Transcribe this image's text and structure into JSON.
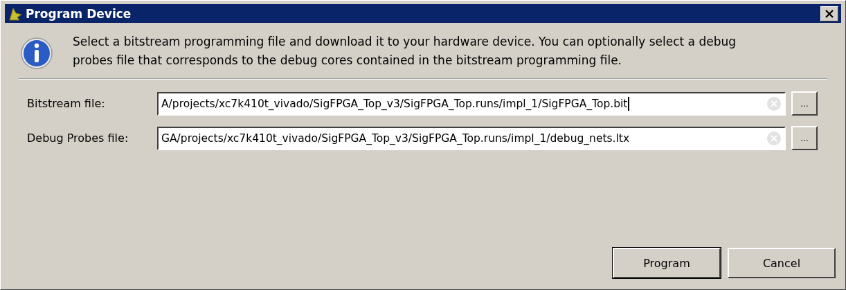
{
  "window": {
    "title": "Program Device"
  },
  "description": "Select a bitstream programming file and download it to your hardware device. You can optionally select a debug probes file that corresponds to the debug cores contained in the bitstream programming file.",
  "fields": [
    {
      "label": "Bitstream file:",
      "value": "A/projects/xc7k410t_vivado/SigFPGA_Top_v3/SigFPGA_Top.runs/impl_1/SigFPGA_Top.bit",
      "focused": true,
      "browse": "..."
    },
    {
      "label": "Debug Probes file:",
      "value": "GA/projects/xc7k410t_vivado/SigFPGA_Top_v3/SigFPGA_Top.runs/impl_1/debug_nets.ltx",
      "focused": false,
      "browse": "..."
    }
  ],
  "buttons": [
    {
      "label": "Program",
      "default": true
    },
    {
      "label": "Cancel",
      "default": false
    }
  ]
}
